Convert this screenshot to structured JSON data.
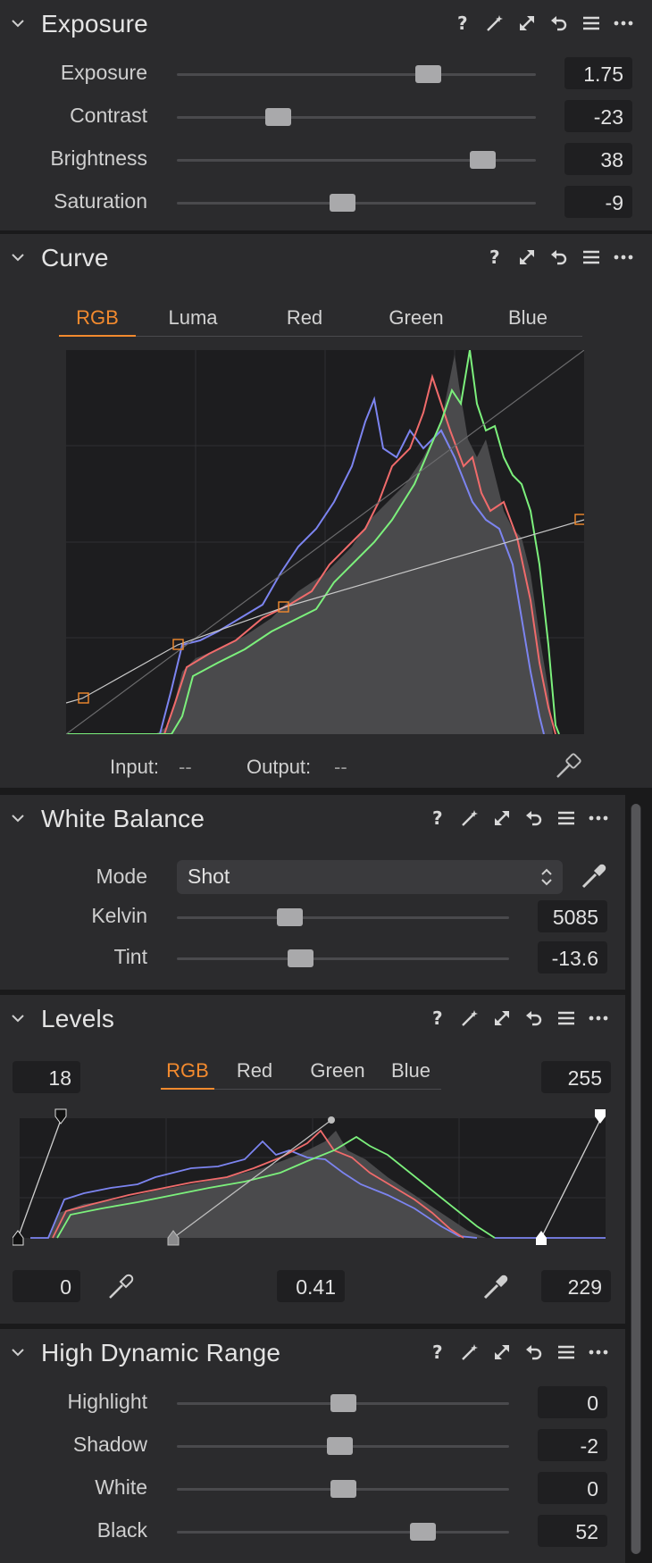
{
  "exposure": {
    "title": "Exposure",
    "sliders": [
      {
        "label": "Exposure",
        "value": "1.75",
        "position": 0.7
      },
      {
        "label": "Contrast",
        "value": "-23",
        "position": 0.28
      },
      {
        "label": "Brightness",
        "value": "38",
        "position": 0.85
      },
      {
        "label": "Saturation",
        "value": "-9",
        "position": 0.46
      }
    ]
  },
  "curve": {
    "title": "Curve",
    "tabs": [
      "RGB",
      "Luma",
      "Red",
      "Green",
      "Blue"
    ],
    "active_tab": "RGB",
    "input_label": "Input:",
    "input_value": "--",
    "output_label": "Output:",
    "output_value": "--"
  },
  "white_balance": {
    "title": "White Balance",
    "mode_label": "Mode",
    "mode_value": "Shot",
    "sliders": [
      {
        "label": "Kelvin",
        "value": "5085",
        "position": 0.34
      },
      {
        "label": "Tint",
        "value": "-13.6",
        "position": 0.37
      }
    ]
  },
  "levels": {
    "title": "Levels",
    "tabs": [
      "RGB",
      "Red",
      "Green",
      "Blue"
    ],
    "active_tab": "RGB",
    "input_low": "18",
    "input_high": "255",
    "output_low": "0",
    "midpoint": "0.41",
    "output_high": "229"
  },
  "hdr": {
    "title": "High Dynamic Range",
    "sliders": [
      {
        "label": "Highlight",
        "value": "0",
        "position": 0.5
      },
      {
        "label": "Shadow",
        "value": "-2",
        "position": 0.49
      },
      {
        "label": "White",
        "value": "0",
        "position": 0.5
      },
      {
        "label": "Black",
        "value": "52",
        "position": 0.74
      }
    ]
  },
  "colors": {
    "accent": "#f28a2e",
    "panel_bg": "#2b2b2d",
    "hist_red": "#f06b6b",
    "hist_green": "#7cf07c",
    "hist_blue": "#7c84f0"
  },
  "icons": [
    "chevron-down-icon",
    "help-icon",
    "magic-wand-icon",
    "copy-apply-icon",
    "reset-icon",
    "menu-icon",
    "more-icon",
    "eyedropper-icon"
  ]
}
